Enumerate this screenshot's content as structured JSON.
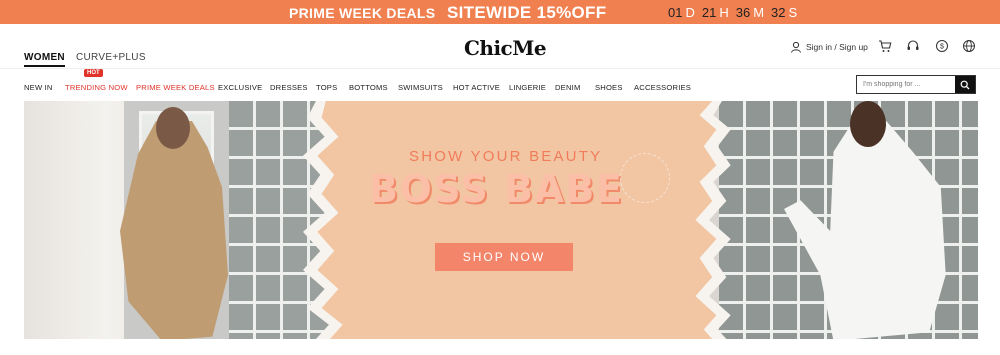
{
  "promo": {
    "prime_week_deals": "PRIME WEEK DEALS",
    "sitewide": "SITEWIDE 15%OFF",
    "timer": [
      {
        "value": "01",
        "unit": "D"
      },
      {
        "value": "21",
        "unit": "H"
      },
      {
        "value": "36",
        "unit": "M"
      },
      {
        "value": "32",
        "unit": "S"
      }
    ]
  },
  "header": {
    "women": "WOMEN",
    "curve_plus": "CURVE+PLUS",
    "logo": "ChicMe",
    "signin": "Sign in / Sign up"
  },
  "nav": {
    "hot_badge": "HOT",
    "items": [
      "NEW IN",
      "TRENDING NOW",
      "PRIME WEEK DEALS",
      "EXCLUSIVE",
      "DRESSES",
      "TOPS",
      "BOTTOMS",
      "SWIMSUITS",
      "HOT ACTIVE",
      "LINGERIE",
      "DENIM",
      "SHOES",
      "ACCESSORIES"
    ],
    "search_placeholder": "I'm shopping for ..."
  },
  "banner": {
    "headline": "SHOW YOUR BEAUTY",
    "title": "BOSS BABE",
    "cta": "SHOP NOW"
  },
  "colors": {
    "promo_bg": "#f08050",
    "accent_red": "#e0332a",
    "cta_bg": "#f3856b"
  }
}
